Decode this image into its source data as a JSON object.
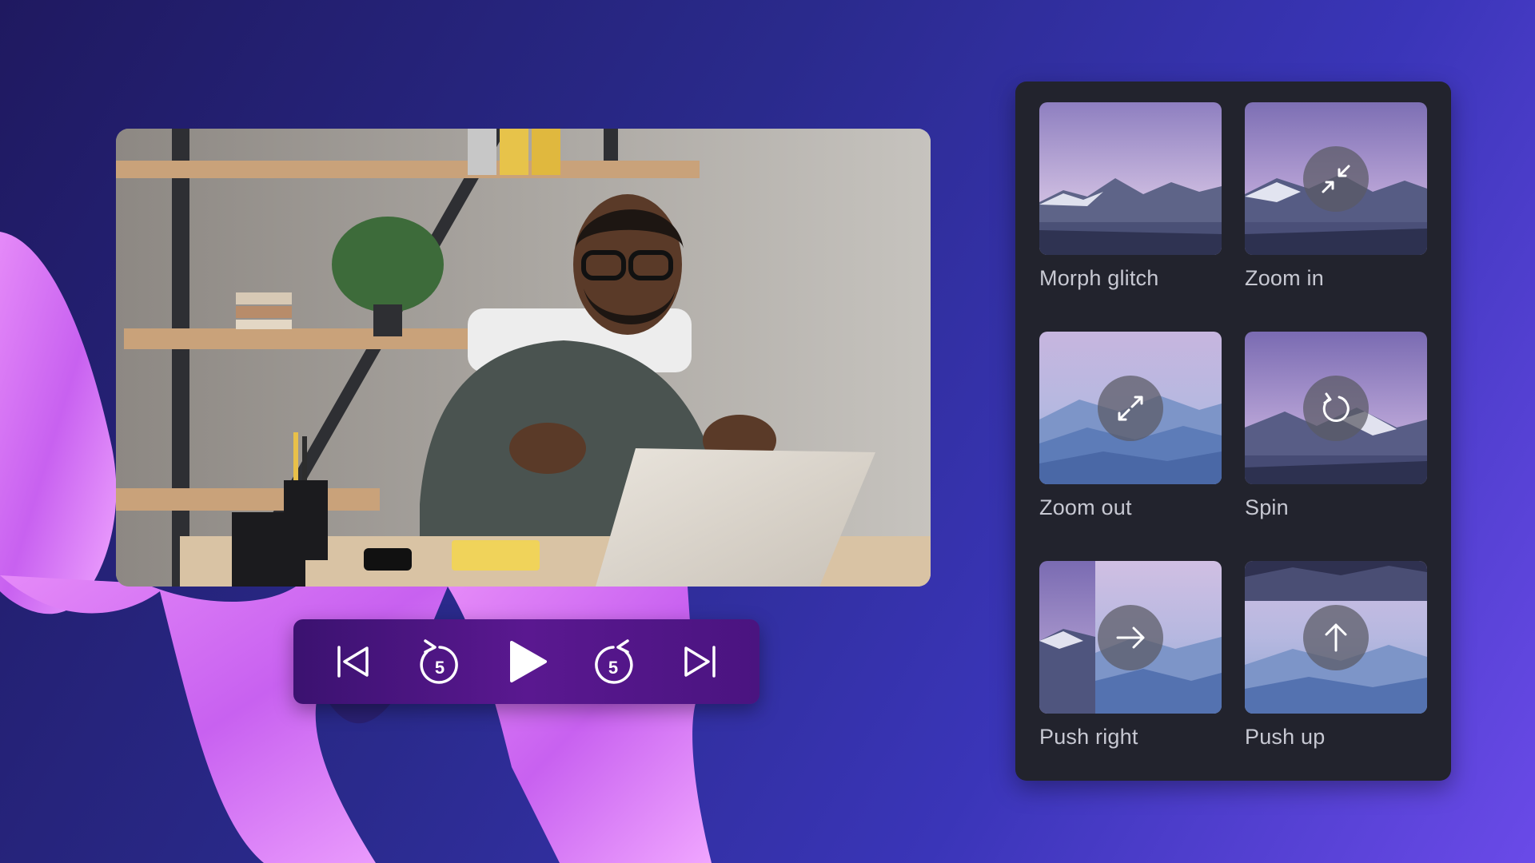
{
  "colors": {
    "background_start": "#1f1960",
    "background_end": "#6a4ae8",
    "wave": "#d879f4",
    "controls_bg": "#4a1480",
    "panel_bg": "#22232d",
    "label_text": "#c7c8d2"
  },
  "player": {
    "controls": [
      {
        "name": "skip-to-start",
        "icon": "skip-back-icon"
      },
      {
        "name": "rewind-5",
        "icon": "rewind-5-icon",
        "label": "5"
      },
      {
        "name": "play",
        "icon": "play-icon"
      },
      {
        "name": "forward-5",
        "icon": "forward-5-icon",
        "label": "5"
      },
      {
        "name": "skip-to-end",
        "icon": "skip-forward-icon"
      }
    ]
  },
  "transitions": [
    {
      "label": "Morph glitch",
      "icon": ""
    },
    {
      "label": "Zoom in",
      "icon": "zoom-in-icon"
    },
    {
      "label": "Zoom out",
      "icon": "zoom-out-icon"
    },
    {
      "label": "Spin",
      "icon": "spin-icon"
    },
    {
      "label": "Push right",
      "icon": "arrow-right-icon"
    },
    {
      "label": "Push up",
      "icon": "arrow-up-icon"
    }
  ]
}
